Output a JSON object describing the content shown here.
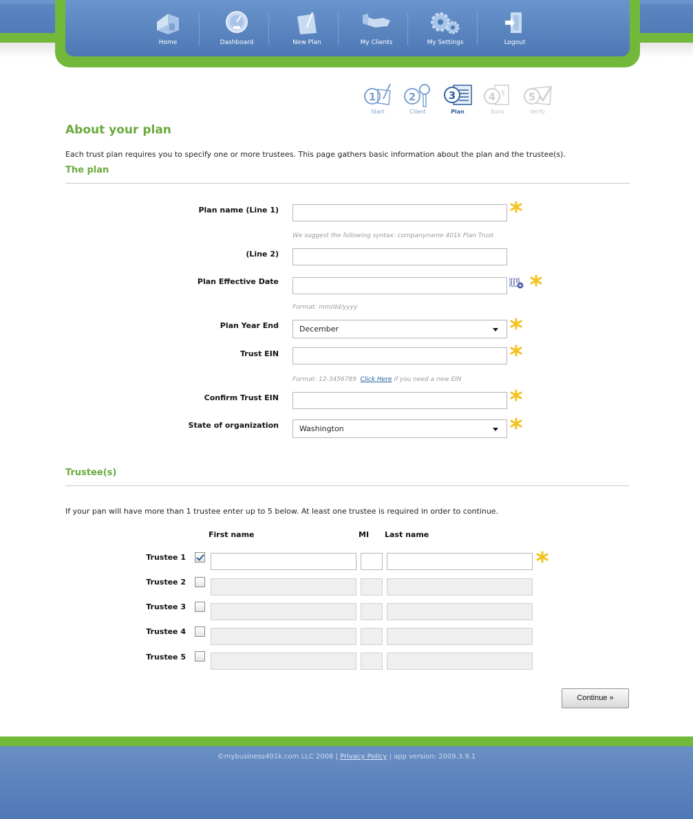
{
  "nav": {
    "items": [
      {
        "label": "Home",
        "icon": "home-icon"
      },
      {
        "label": "Dashboard",
        "icon": "dashboard-gauge-icon"
      },
      {
        "label": "New Plan",
        "icon": "new-plan-icon"
      },
      {
        "label": "My Clients",
        "icon": "handshake-icon"
      },
      {
        "label": "My Settings",
        "icon": "gears-icon"
      },
      {
        "label": "Logout",
        "icon": "logout-door-icon"
      }
    ]
  },
  "steps": [
    {
      "label": "Start",
      "number": "1",
      "state": "done"
    },
    {
      "label": "Client",
      "number": "2",
      "state": "done"
    },
    {
      "label": "Plan",
      "number": "3",
      "state": "active"
    },
    {
      "label": "Bank",
      "number": "4",
      "state": "disabled"
    },
    {
      "label": "Verify",
      "number": "5",
      "state": "disabled"
    }
  ],
  "page": {
    "title": "About your plan",
    "intro": "Each trust plan requires you to specify one or more trustees. This page gathers basic information about the plan and the trustee(s)."
  },
  "plan_section": {
    "title": "The plan",
    "fields": {
      "plan_name_label": "Plan name (Line 1)",
      "plan_name_value": "",
      "plan_name_hint": "We suggest the following syntax: companyname 401k Plan Trust",
      "line2_label": "(Line 2)",
      "line2_value": "",
      "effective_date_label": "Plan Effective Date",
      "effective_date_value": "",
      "effective_date_hint": "Format: mm/dd/yyyy",
      "year_end_label": "Plan Year End",
      "year_end_value": "December",
      "trust_ein_label": "Trust EIN",
      "trust_ein_value": "",
      "trust_ein_hint_prefix": "Format: 12-3456789",
      "trust_ein_hint_link": "Click Here",
      "trust_ein_hint_suffix": "if you need a new EIN",
      "confirm_ein_label": "Confirm Trust EIN",
      "confirm_ein_value": "",
      "state_label": "State of organization",
      "state_value": "Washington"
    }
  },
  "trustees_section": {
    "title": "Trustee(s)",
    "intro": "If your pan will have more than 1 trustee enter up to 5 below. At least one trustee is required in order to continue.",
    "columns": {
      "first": "First name",
      "mi": "MI",
      "last": "Last name"
    },
    "rows": [
      {
        "label": "Trustee 1",
        "checked": true,
        "first": "",
        "mi": "",
        "last": ""
      },
      {
        "label": "Trustee 2",
        "checked": false,
        "first": "",
        "mi": "",
        "last": ""
      },
      {
        "label": "Trustee 3",
        "checked": false,
        "first": "",
        "mi": "",
        "last": ""
      },
      {
        "label": "Trustee 4",
        "checked": false,
        "first": "",
        "mi": "",
        "last": ""
      },
      {
        "label": "Trustee 5",
        "checked": false,
        "first": "",
        "mi": "",
        "last": ""
      }
    ]
  },
  "actions": {
    "continue_label": "Continue »"
  },
  "footer": {
    "copyright": "©mybusiness401k.com LLC 2008",
    "sep1": "|",
    "privacy_link": "Privacy Policy",
    "sep2": "|",
    "version": "app version: 2009.3.9.1"
  },
  "colors": {
    "brand_blue": "#5b86c2",
    "brand_green": "#72b83b",
    "heading_green": "#6aaa3c",
    "required_star": "#f2c21b"
  }
}
